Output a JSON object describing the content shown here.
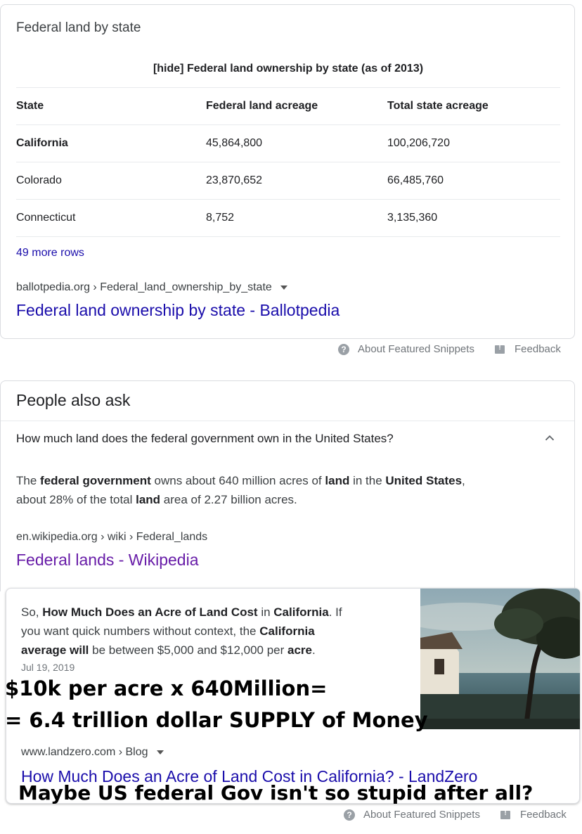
{
  "featured_snippet": {
    "title": "Federal land by state",
    "table_caption": "[hide] Federal land ownership by state (as of 2013)",
    "columns": [
      "State",
      "Federal land acreage",
      "Total state acreage"
    ],
    "rows": [
      [
        "California",
        "45,864,800",
        "100,206,720"
      ],
      [
        "Colorado",
        "23,870,652",
        "66,485,760"
      ],
      [
        "Connecticut",
        "8,752",
        "3,135,360"
      ]
    ],
    "more_rows": "49 more rows",
    "breadcrumb": "ballotpedia.org › Federal_land_ownership_by_state",
    "link": "Federal land ownership by state - Ballotpedia"
  },
  "footer1": {
    "about": "About Featured Snippets",
    "feedback": "Feedback"
  },
  "paa": {
    "title": "People also ask",
    "question": "How much land does the federal government own in the United States?",
    "answer_parts": [
      "The ",
      "federal government",
      " owns about 640 million acres of ",
      "land",
      " in the ",
      "United States",
      ",",
      " about 28% of the total ",
      "land",
      " area of 2.27 billion acres."
    ],
    "breadcrumb": "en.wikipedia.org › wiki › Federal_lands",
    "link": "Federal lands - Wikipedia"
  },
  "snippet2": {
    "text_parts": [
      "So, ",
      "How Much Does an Acre of Land Cost",
      " in ",
      "California",
      ". If",
      "you want quick numbers without context, the ",
      "California",
      "average will",
      " be between $5,000 and $12,000 per ",
      "acre",
      "."
    ],
    "date": "Jul 19, 2019",
    "breadcrumb": "www.landzero.com › Blog",
    "link": "How Much Does an Acre of Land Cost in California? - LandZero",
    "image_icon": "beach-house-tree-photo"
  },
  "overlay": {
    "line1": "$10k per acre x 640Million=",
    "line2": "= 6.4 trillion dollar SUPPLY of Money",
    "line3": "Maybe US federal Gov isn't so stupid after all?"
  },
  "footer2": {
    "about": "About Featured Snippets",
    "feedback": "Feedback"
  },
  "colors": {
    "link": "#1a0dab",
    "visited": "#681da8",
    "border": "#dadce0",
    "muted": "#70757a"
  }
}
